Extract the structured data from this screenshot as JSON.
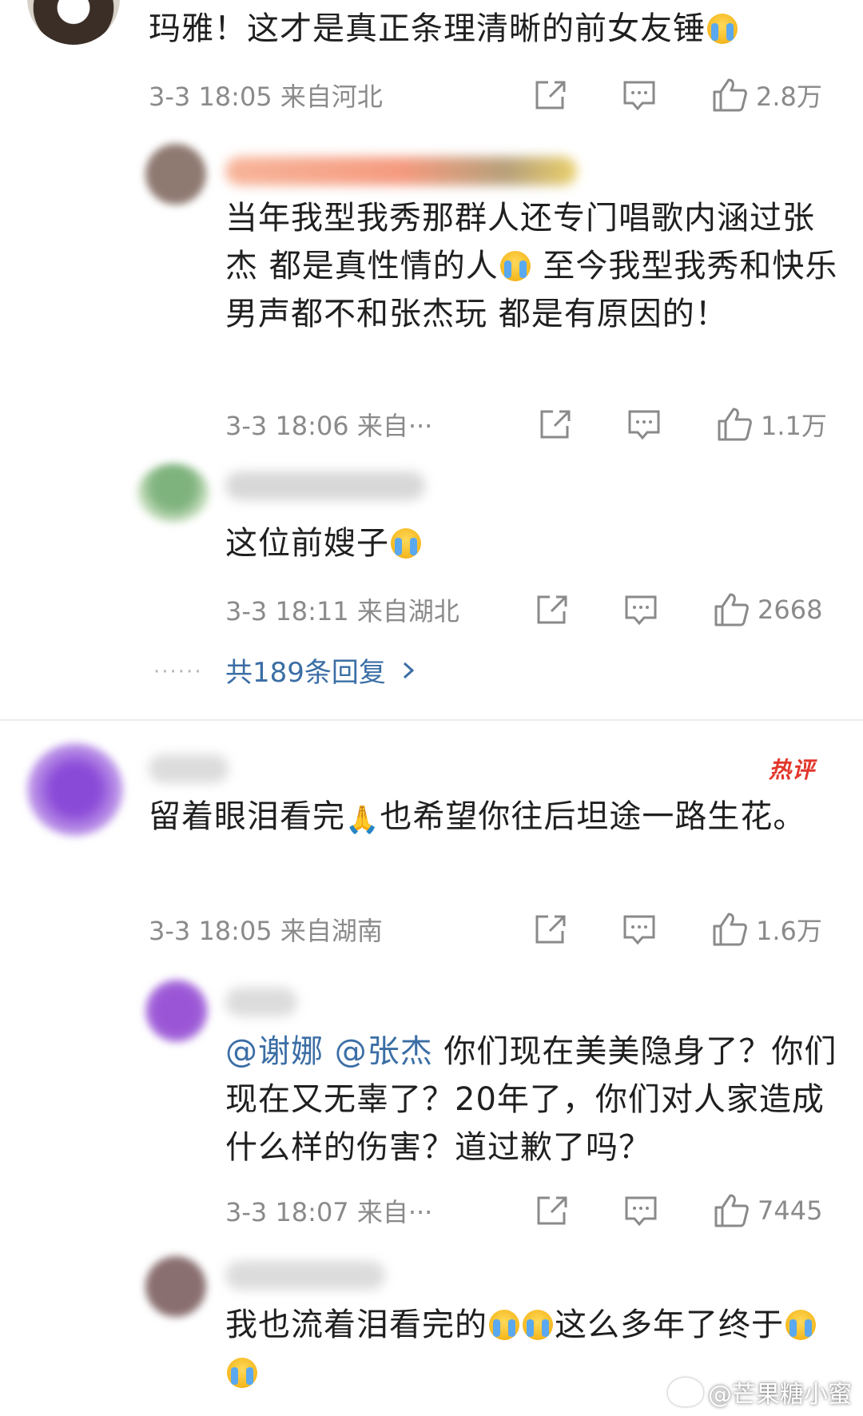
{
  "comments": [
    {
      "text": "玛雅！这才是真正条理清晰的前女友锤",
      "time": "3-3 18:05",
      "location": "来自河北",
      "likes": "2.8万",
      "replies": [
        {
          "text": "当年我型我秀那群人还专门唱歌内涵过张杰 都是真性情的人",
          "text_after": " 至今我型我秀和快乐男声都不和张杰玩 都是有原因的！",
          "time": "3-3 18:06",
          "location": "来自···",
          "likes": "1.1万"
        },
        {
          "text": "这位前嫂子",
          "time": "3-3 18:11",
          "location": "来自湖北",
          "likes": "2668"
        }
      ],
      "more_replies": "共189条回复",
      "more_dots": "······"
    },
    {
      "badge": "热评",
      "text": "留着眼泪看完",
      "text_after": "也希望你往后坦途一路生花。",
      "time": "3-3 18:05",
      "location": "来自湖南",
      "likes": "1.6万",
      "replies": [
        {
          "mention_1": "@谢娜",
          "mention_2": "@张杰",
          "text": " 你们现在美美隐身了？你们现在又无辜了？20年了，你们对人家造成什么样的伤害？道过歉了吗？",
          "time": "3-3 18:07",
          "location": "来自···",
          "likes": "7445"
        },
        {
          "text": "我也流着泪看完的",
          "text_mid": "这么多年了终于",
          "time": "",
          "location": "",
          "likes": ""
        }
      ]
    }
  ],
  "watermark": "@芒果糖小蜜",
  "icons": {
    "share": "share-icon",
    "comment": "comment-icon",
    "like": "thumbs-up-icon",
    "more": "chevron-right-icon",
    "emoji": "crying-emoji"
  },
  "colors": {
    "link": "#3b6ea5",
    "meta": "#8a8a8a",
    "badge": "#e2372b"
  }
}
